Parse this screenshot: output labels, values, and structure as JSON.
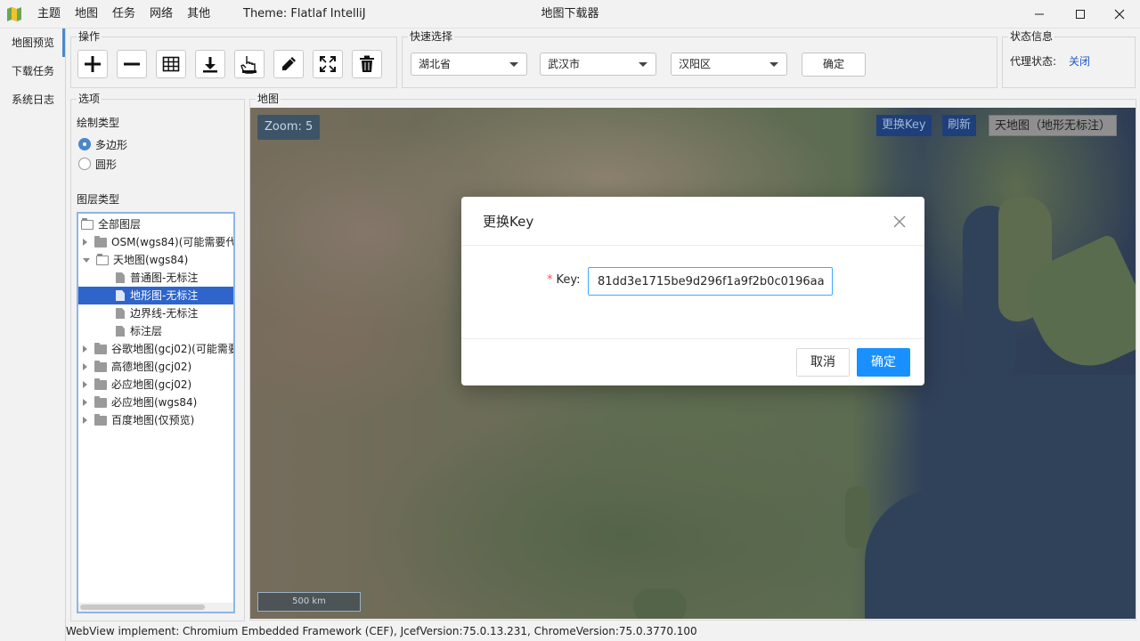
{
  "titlebar": {
    "menu": [
      "主题",
      "地图",
      "任务",
      "网络",
      "其他"
    ],
    "theme_label": "Theme: Flatlaf IntelliJ",
    "window_title": "地图下载器"
  },
  "tabs": [
    "地图预览",
    "下载任务",
    "系统日志"
  ],
  "operations": {
    "title": "操作",
    "tools": [
      "add-icon",
      "remove-icon",
      "grid-icon",
      "download-icon",
      "hand-pointer-icon",
      "pencil-icon",
      "fullscreen-icon",
      "trash-icon"
    ]
  },
  "quick_select": {
    "title": "快速选择",
    "province": "湖北省",
    "city": "武汉市",
    "district": "汉阳区",
    "confirm_label": "确定"
  },
  "status_info": {
    "title": "状态信息",
    "proxy_label": "代理状态:",
    "proxy_value": "关闭"
  },
  "options": {
    "title": "选项",
    "draw_type_label": "绘制类型",
    "draw_types": [
      "多边形",
      "圆形"
    ],
    "selected_draw_type": "多边形",
    "layer_type_label": "图层类型"
  },
  "layer_tree": [
    {
      "label": "全部图层",
      "level": 0,
      "kind": "root"
    },
    {
      "label": "OSM(wgs84)(可能需要代",
      "level": 1,
      "kind": "folder"
    },
    {
      "label": "天地图(wgs84)",
      "level": 1,
      "kind": "folder-open"
    },
    {
      "label": "普通图-无标注",
      "level": 2,
      "kind": "leaf"
    },
    {
      "label": "地形图-无标注",
      "level": 2,
      "kind": "leaf",
      "selected": true
    },
    {
      "label": "边界线-无标注",
      "level": 2,
      "kind": "leaf"
    },
    {
      "label": "标注层",
      "level": 2,
      "kind": "leaf"
    },
    {
      "label": "谷歌地图(gcj02)(可能需要",
      "level": 1,
      "kind": "folder"
    },
    {
      "label": "高德地图(gcj02)",
      "level": 1,
      "kind": "folder"
    },
    {
      "label": "必应地图(gcj02)",
      "level": 1,
      "kind": "folder"
    },
    {
      "label": "必应地图(wgs84)",
      "level": 1,
      "kind": "folder"
    },
    {
      "label": "百度地图(仅预览)",
      "level": 1,
      "kind": "folder"
    }
  ],
  "map": {
    "title": "地图",
    "zoom_label": "Zoom: 5",
    "change_key_label": "更换Key",
    "refresh_label": "刷新",
    "layer_name": "天地图（地形无标注）",
    "scale_label": "500 km"
  },
  "dialog": {
    "title": "更换Key",
    "field_label": "Key:",
    "key_value": "81dd3e1715be9d296f1a9f2b0c0196aa",
    "cancel_label": "取消",
    "ok_label": "确定"
  },
  "statusbar": "WebView implement: Chromium Embedded Framework (CEF), JcefVersion:75.0.13.231, ChromeVersion:75.0.3770.100",
  "colors": {
    "accent": "#4a88c7",
    "primary_button": "#1890ff",
    "selection": "#2f65ca"
  }
}
